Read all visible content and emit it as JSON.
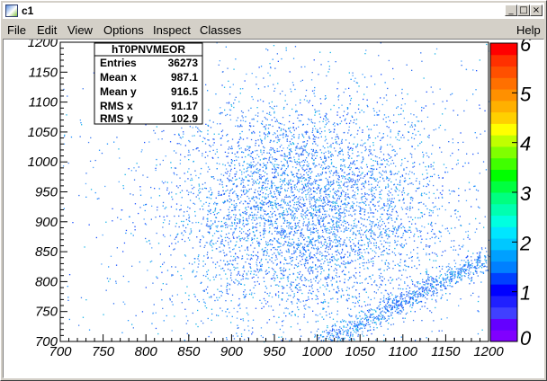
{
  "window": {
    "title": "c1",
    "icon": "root-canvas-icon",
    "buttons": [
      "_",
      "□",
      "×"
    ]
  },
  "menu": {
    "items": [
      "File",
      "Edit",
      "View",
      "Options",
      "Inspect",
      "Classes"
    ],
    "help": "Help"
  },
  "stats": {
    "title": "hT0PNVMEOR",
    "rows": [
      {
        "label": "Entries",
        "value": "36273"
      },
      {
        "label": "Mean x",
        "value": "987.1"
      },
      {
        "label": "Mean y",
        "value": "916.5"
      },
      {
        "label": "RMS x",
        "value": "91.17"
      },
      {
        "label": "RMS y",
        "value": "102.9"
      }
    ]
  },
  "chart_data": {
    "type": "heatmap",
    "title": "",
    "xlabel": "",
    "ylabel": "",
    "xlim": [
      700,
      1200
    ],
    "ylim": [
      700,
      1200
    ],
    "x_ticks": [
      700,
      750,
      800,
      850,
      900,
      950,
      1000,
      1050,
      1100,
      1150,
      1200
    ],
    "y_ticks": [
      700,
      750,
      800,
      850,
      900,
      950,
      1000,
      1050,
      1100,
      1150,
      1200
    ],
    "entries": 36273,
    "mean_x": 987.1,
    "mean_y": 916.5,
    "rms_x": 91.17,
    "rms_y": 102.9,
    "z_range": [
      0,
      6
    ],
    "z_ticks": [
      0,
      1,
      2,
      3,
      4,
      5,
      6
    ],
    "palette": [
      "#8000ff",
      "#6400ff",
      "#4040ff",
      "#2020ff",
      "#0000ff",
      "#0040ff",
      "#0080ff",
      "#00a0ff",
      "#00c8ff",
      "#00e6ff",
      "#00ffe0",
      "#00ffb0",
      "#00ff80",
      "#00ff40",
      "#00ff00",
      "#40ff00",
      "#80ff00",
      "#c0ff00",
      "#ffff00",
      "#ffd000",
      "#ffb000",
      "#ff9000",
      "#ff7000",
      "#ff5000",
      "#ff3000",
      "#ff0000"
    ],
    "grid": false,
    "legend": "stats-box top-left; color palette right"
  }
}
